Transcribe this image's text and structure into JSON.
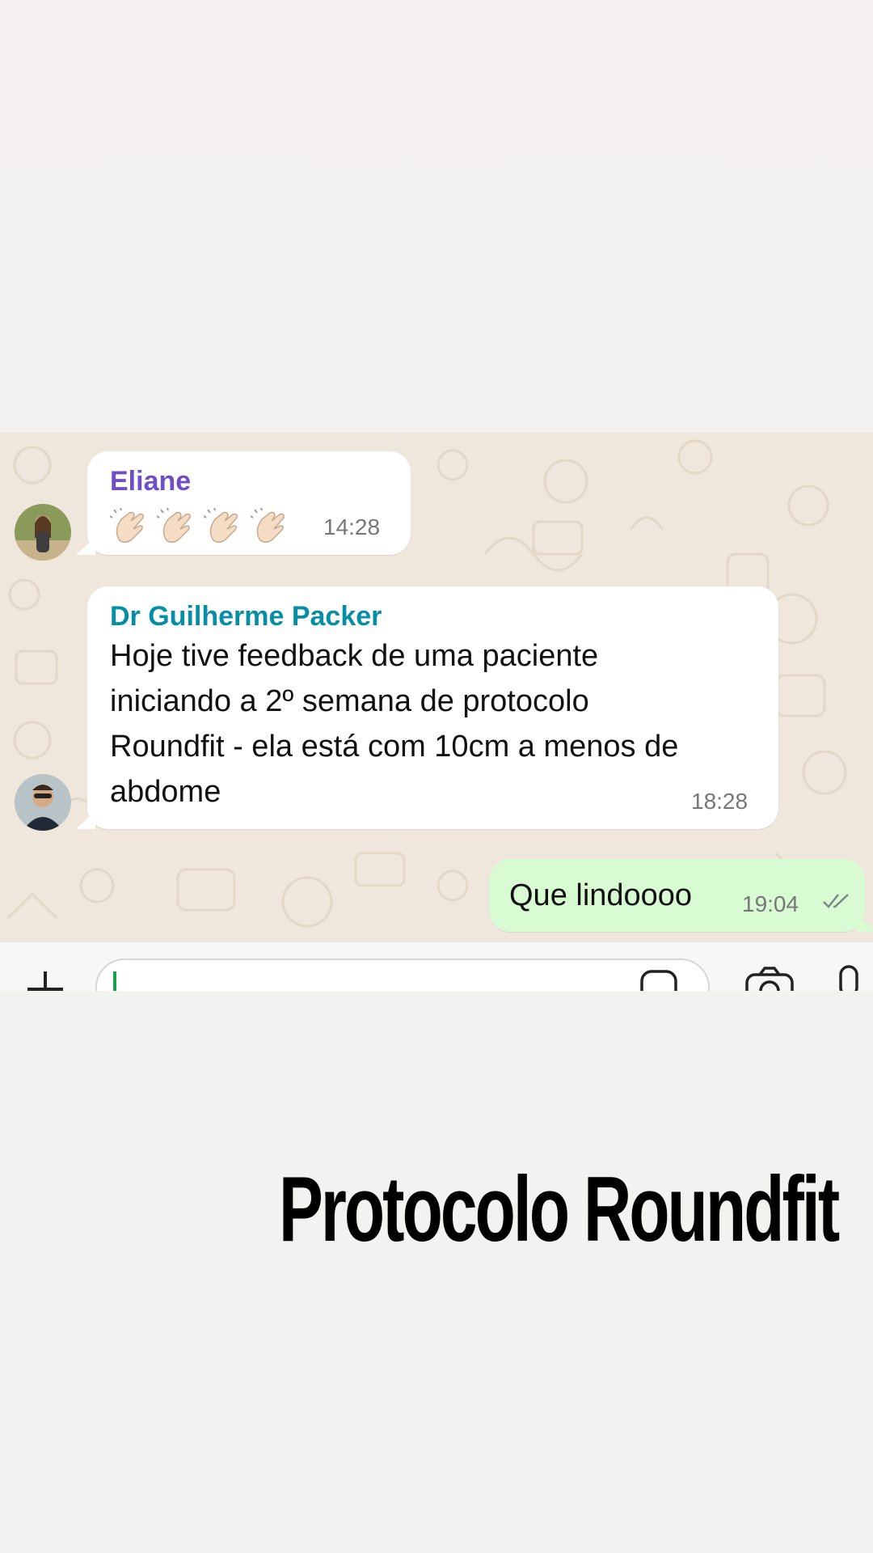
{
  "messages": [
    {
      "sender": "Eliane",
      "sender_color": "#6f4fc8",
      "emoji": [
        "👏🏻",
        "👏🏻",
        "👏🏻",
        "👏🏻"
      ],
      "time": "14:28"
    },
    {
      "sender": "Dr Guilherme Packer",
      "sender_color": "#078ea7",
      "text_lines": [
        "Hoje tive feedback de uma paciente",
        "iniciando a 2º semana de protocolo",
        "Roundfit - ela está com 10cm a menos de",
        "abdome"
      ],
      "time": "18:28"
    },
    {
      "text": "Que lindoooo",
      "time": "19:04",
      "status_icon": "double-check-icon"
    }
  ],
  "composer": {
    "attach_icon": "plus-icon",
    "sticker_icon": "sticker-icon",
    "camera_icon": "camera-icon",
    "mic_icon": "microphone-icon"
  },
  "caption": "Protocolo Roundfit",
  "colors": {
    "outgoing_bubble": "#d8fbd3",
    "chat_background": "#efe7dc",
    "accent": "#16a34a"
  }
}
